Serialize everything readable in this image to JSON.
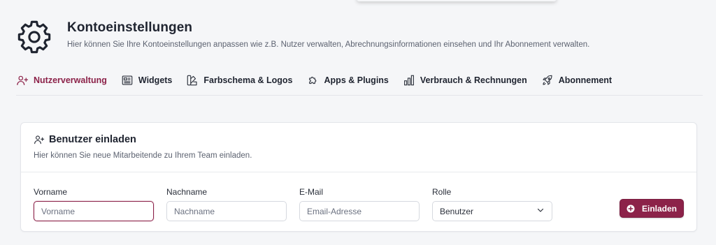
{
  "header": {
    "title": "Kontoeinstellungen",
    "subtitle": "Hier können Sie Ihre Kontoeinstellungen anpassen wie z.B. Nutzer verwalten, Abrechnungsinformationen einsehen und Ihr Abonnement verwalten.",
    "icon": "gear-icon"
  },
  "tabs": [
    {
      "label": "Nutzerverwaltung",
      "icon": "user-plus-icon",
      "active": true
    },
    {
      "label": "Widgets",
      "icon": "newspaper-icon",
      "active": false
    },
    {
      "label": "Farbschema & Logos",
      "icon": "palette-swatch-icon",
      "active": false
    },
    {
      "label": "Apps & Plugins",
      "icon": "puzzle-icon",
      "active": false
    },
    {
      "label": "Verbrauch & Rechnungen",
      "icon": "bar-chart-icon",
      "active": false
    },
    {
      "label": "Abonnement",
      "icon": "rocket-icon",
      "active": false
    }
  ],
  "invite_card": {
    "title": "Benutzer einladen",
    "description": "Hier können Sie neue Mitarbeitende zu Ihrem Team einladen.",
    "icon": "user-plus-icon",
    "fields": {
      "first_name": {
        "label": "Vorname",
        "placeholder": "Vorname",
        "value": ""
      },
      "last_name": {
        "label": "Nachname",
        "placeholder": "Nachname",
        "value": ""
      },
      "email": {
        "label": "E-Mail",
        "placeholder": "Email-Adresse",
        "value": ""
      },
      "role": {
        "label": "Rolle",
        "selected": "Benutzer"
      }
    },
    "submit_label": "Einladen",
    "submit_icon": "plus-circle-icon"
  },
  "colors": {
    "accent": "#8c2249",
    "text": "#1f2430",
    "muted": "#5c6270",
    "background": "#f5f6f8"
  }
}
